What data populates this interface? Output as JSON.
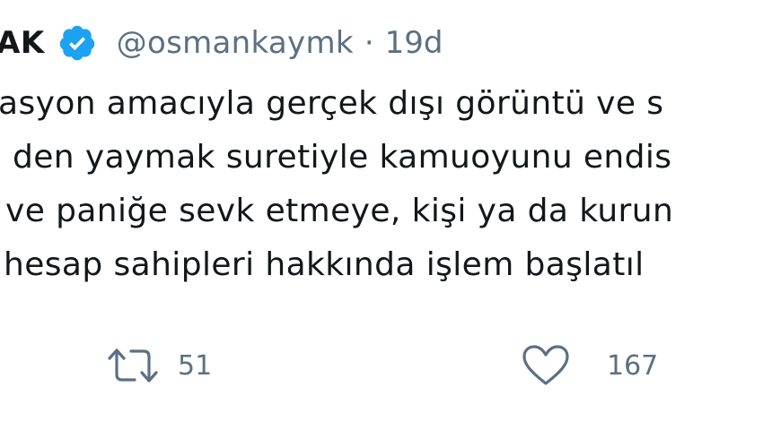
{
  "tweet": {
    "display_name": "AK",
    "handle": "@osmankaymk",
    "separator": "·",
    "time": "19d",
    "lines": [
      "asyon amacıyla gerçek dışı görüntü ve s",
      "den yaymak suretiyle kamuoyunu endis",
      "ve paniğe sevk etmeye, kişi ya da kurun",
      "hesap sahipleri hakkında işlem başlatıl"
    ]
  },
  "actions": {
    "retweet_count": "51",
    "like_count": "167"
  },
  "colors": {
    "verified_badge": "#1da1f2",
    "secondary_text": "#5b7083",
    "primary_text": "#14171a"
  }
}
